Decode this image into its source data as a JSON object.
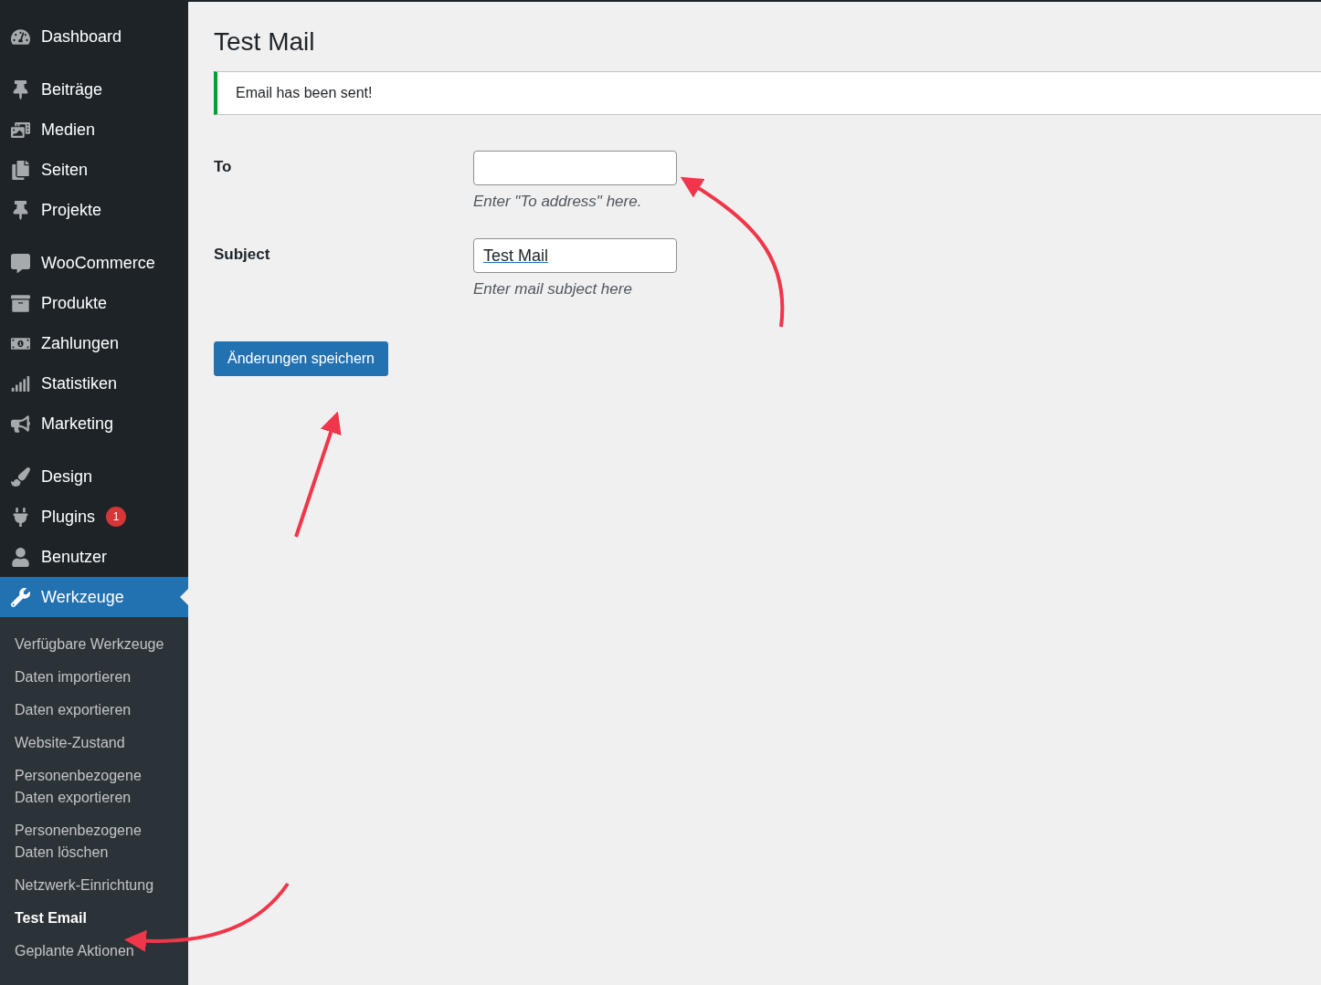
{
  "sidebar": {
    "groups": [
      [
        {
          "label": "Dashboard",
          "selected": false
        }
      ],
      [
        {
          "label": "Beiträge",
          "selected": false
        },
        {
          "label": "Medien",
          "selected": false
        },
        {
          "label": "Seiten",
          "selected": false
        },
        {
          "label": "Projekte",
          "selected": false
        }
      ],
      [
        {
          "label": "WooCommerce",
          "selected": false
        },
        {
          "label": "Produkte",
          "selected": false
        },
        {
          "label": "Zahlungen",
          "selected": false
        },
        {
          "label": "Statistiken",
          "selected": false
        },
        {
          "label": "Marketing",
          "selected": false
        }
      ],
      [
        {
          "label": "Design",
          "selected": false
        },
        {
          "label": "Plugins",
          "selected": false,
          "badge": "1"
        },
        {
          "label": "Benutzer",
          "selected": false
        },
        {
          "label": "Werkzeuge",
          "selected": true
        }
      ]
    ],
    "submenu": [
      {
        "label": "Verfügbare Werkzeuge",
        "selected": false
      },
      {
        "label": "Daten importieren",
        "selected": false
      },
      {
        "label": "Daten exportieren",
        "selected": false
      },
      {
        "label": "Website-Zustand",
        "selected": false
      },
      {
        "label": "Personenbezogene Daten exportieren",
        "selected": false
      },
      {
        "label": "Personenbezogene Daten löschen",
        "selected": false
      },
      {
        "label": "Netzwerk-Einrichtung",
        "selected": false
      },
      {
        "label": "Test Email",
        "selected": true
      },
      {
        "label": "Geplante Aktionen",
        "selected": false
      }
    ]
  },
  "page": {
    "title": "Test Mail",
    "notice": "Email has been sent!",
    "fields": [
      {
        "label": "To",
        "description": "Enter \"To address\" here."
      },
      {
        "label": "Subject",
        "value": "Test Mail",
        "description": "Enter mail subject here"
      }
    ],
    "save_button": "Änderungen speichern"
  }
}
